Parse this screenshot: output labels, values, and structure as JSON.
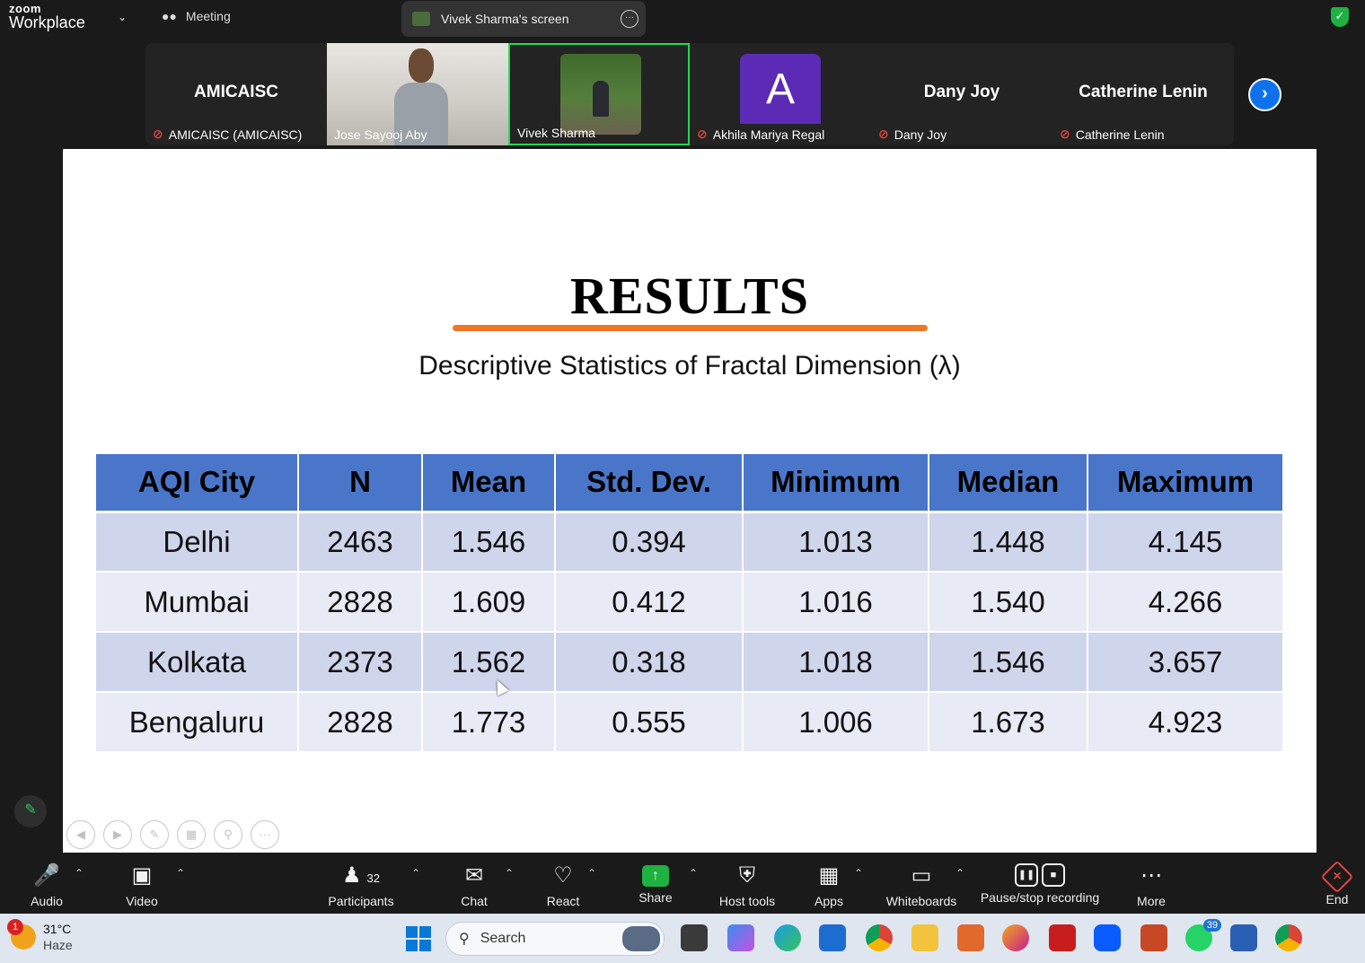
{
  "topbar": {
    "logo_small": "zoom",
    "logo_big": "Workplace",
    "meeting_label": "Meeting",
    "screen_label": "Vivek Sharma's screen"
  },
  "participants_strip": [
    {
      "name_big": "AMICAISC",
      "label": "AMICAISC (AMICAISC)",
      "muted": true
    },
    {
      "name_big": "",
      "label": "Jose Sayooj Aby",
      "muted": false
    },
    {
      "name_big": "",
      "label": "Vivek Sharma",
      "muted": false
    },
    {
      "name_big": "",
      "avatar_letter": "A",
      "label": "Akhila Mariya Regal",
      "muted": true
    },
    {
      "name_big": "Dany Joy",
      "label": "Dany Joy",
      "muted": true
    },
    {
      "name_big": "Catherine Lenin",
      "label": "Catherine Lenin",
      "muted": true
    }
  ],
  "slide": {
    "title": "RESULTS",
    "subtitle": "Descriptive Statistics of Fractal Dimension (λ)",
    "table": {
      "headers": [
        "AQI City",
        "N",
        "Mean",
        "Std. Dev.",
        "Minimum",
        "Median",
        "Maximum"
      ],
      "rows": [
        [
          "Delhi",
          "2463",
          "1.546",
          "0.394",
          "1.013",
          "1.448",
          "4.145"
        ],
        [
          "Mumbai",
          "2828",
          "1.609",
          "0.412",
          "1.016",
          "1.540",
          "4.266"
        ],
        [
          "Kolkata",
          "2373",
          "1.562",
          "0.318",
          "1.018",
          "1.546",
          "3.657"
        ],
        [
          "Bengaluru",
          "2828",
          "1.773",
          "0.555",
          "1.006",
          "1.673",
          "4.923"
        ]
      ]
    }
  },
  "toolbar": {
    "audio": "Audio",
    "video": "Video",
    "participants": "Participants",
    "participants_count": "32",
    "chat": "Chat",
    "react": "React",
    "share": "Share",
    "host_tools": "Host tools",
    "apps": "Apps",
    "whiteboards": "Whiteboards",
    "recording": "Pause/stop recording",
    "more": "More",
    "end": "End"
  },
  "taskbar": {
    "weather_badge": "1",
    "temperature": "31°C",
    "condition": "Haze",
    "search_placeholder": "Search",
    "whatsapp_badge": "39"
  },
  "colors": {
    "header_blue": "#4a76c9",
    "row_odd": "#cfd5ea",
    "row_even": "#e8eaf5",
    "underline_orange": "#ee7726",
    "active_speaker": "#23d959",
    "muted_red": "#e0453e"
  }
}
